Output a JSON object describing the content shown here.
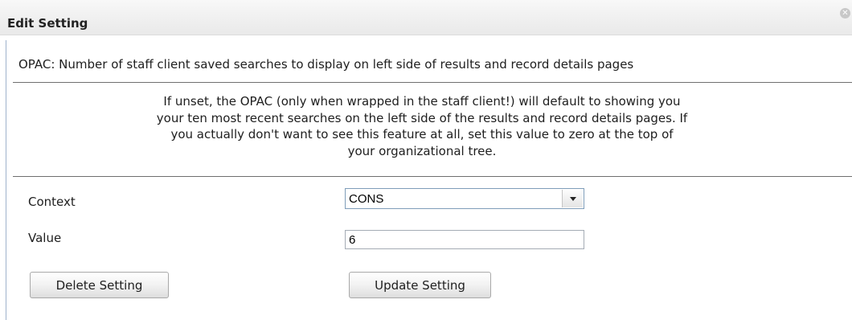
{
  "dialog": {
    "title": "Edit Setting",
    "close_icon": "close-icon",
    "description": "OPAC: Number of staff client saved searches to display on left side of results and record details pages",
    "help_lines": [
      "If unset, the OPAC (only when wrapped in the staff client!) will default to showing you",
      "your ten most recent searches on the left side of the results and record details pages. If",
      "you actually don't want to see this feature at all, set this value to zero at the top of",
      "your organizational tree."
    ]
  },
  "form": {
    "context_label": "Context",
    "context_value": "CONS",
    "value_label": "Value",
    "value": "6"
  },
  "buttons": {
    "delete_label": "Delete Setting",
    "update_label": "Update Setting"
  }
}
